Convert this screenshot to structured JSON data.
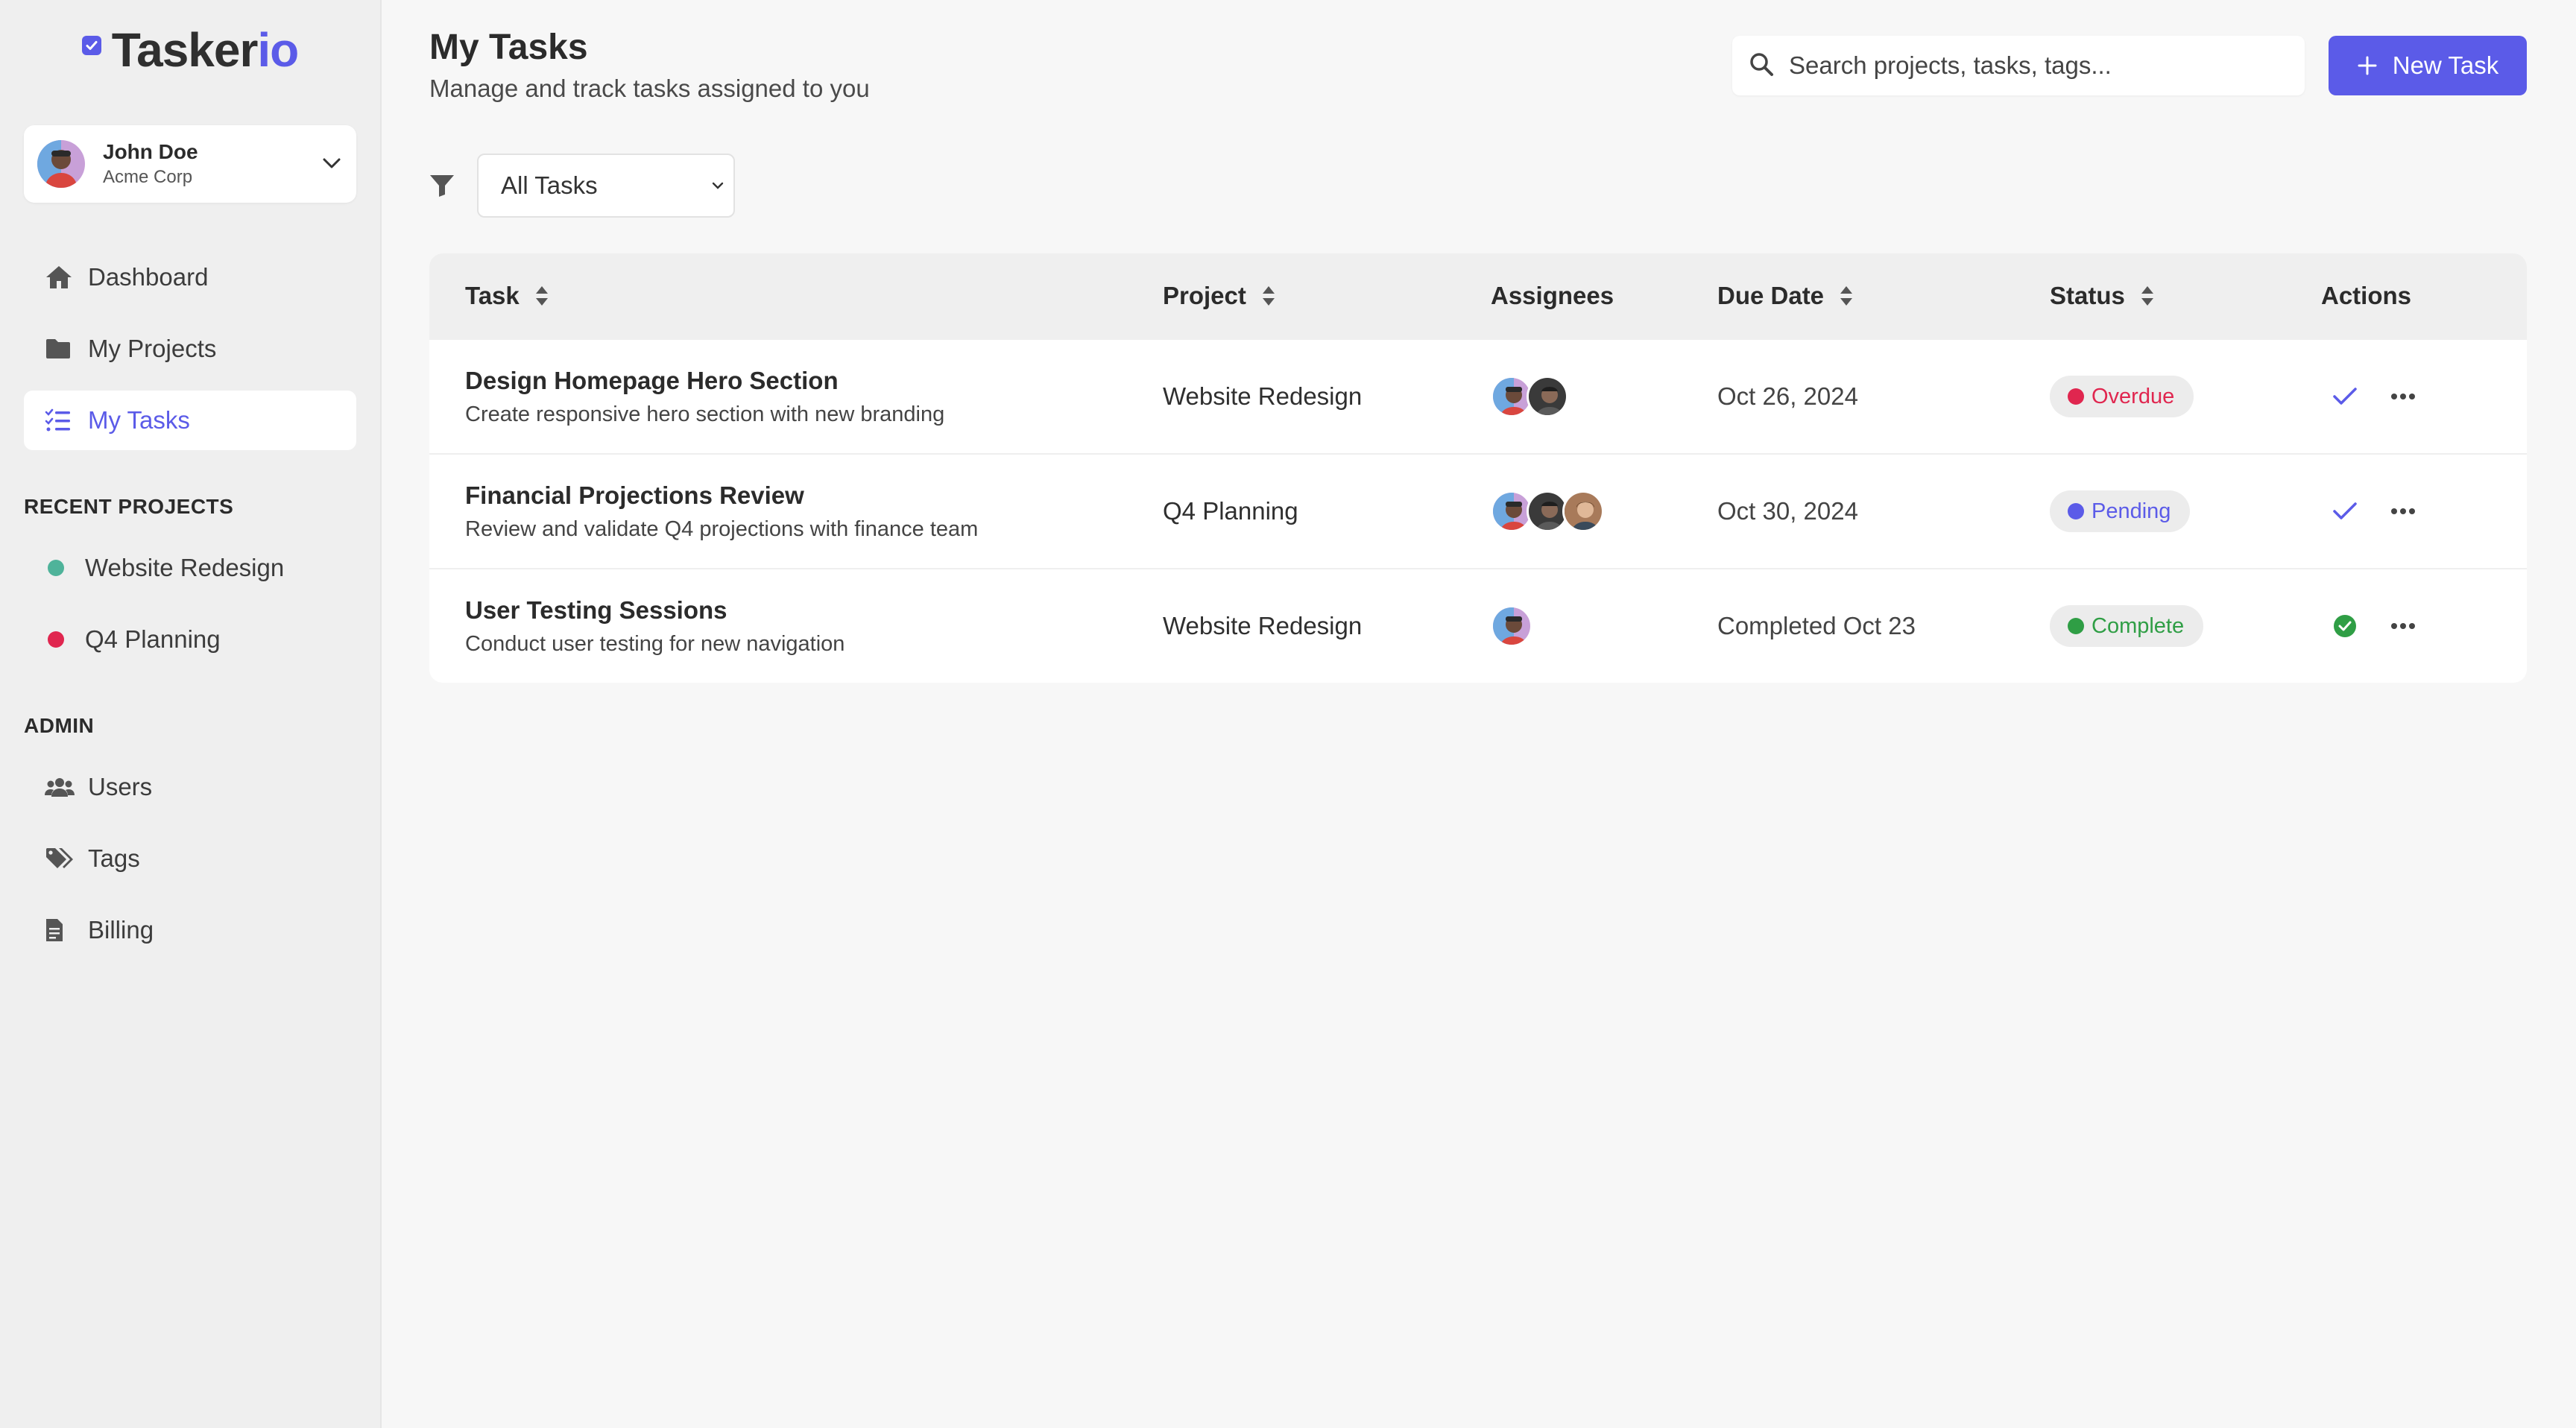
{
  "app": {
    "logo_main": "Tasker",
    "logo_accent": "io"
  },
  "user": {
    "name": "John Doe",
    "org": "Acme Corp"
  },
  "nav": {
    "items": [
      {
        "label": "Dashboard",
        "icon": "home-icon"
      },
      {
        "label": "My Projects",
        "icon": "folder-icon"
      },
      {
        "label": "My Tasks",
        "icon": "task-list-icon",
        "active": true
      }
    ]
  },
  "recent_projects": {
    "title": "RECENT PROJECTS",
    "items": [
      {
        "label": "Website Redesign",
        "color": "#4fb39a"
      },
      {
        "label": "Q4 Planning",
        "color": "#e0264f"
      }
    ]
  },
  "admin": {
    "title": "ADMIN",
    "items": [
      {
        "label": "Users",
        "icon": "users-icon"
      },
      {
        "label": "Tags",
        "icon": "tags-icon"
      },
      {
        "label": "Billing",
        "icon": "billing-icon"
      }
    ]
  },
  "header": {
    "title": "My Tasks",
    "subtitle": "Manage and track tasks assigned to you",
    "search_placeholder": "Search projects, tasks, tags...",
    "new_task_label": "New Task"
  },
  "filter": {
    "selected": "All Tasks"
  },
  "table": {
    "columns": [
      "Task",
      "Project",
      "Assignees",
      "Due Date",
      "Status",
      "Actions"
    ],
    "rows": [
      {
        "title": "Design Homepage Hero Section",
        "description": "Create responsive hero section with new branding",
        "project": "Website Redesign",
        "assignees": 2,
        "due": "Oct 26, 2024",
        "status": "Overdue",
        "status_class": "overdue",
        "action": "check"
      },
      {
        "title": "Financial Projections Review",
        "description": "Review and validate Q4 projections with finance team",
        "project": "Q4 Planning",
        "assignees": 3,
        "due": "Oct 30, 2024",
        "status": "Pending",
        "status_class": "pending",
        "action": "check"
      },
      {
        "title": "User Testing Sessions",
        "description": "Conduct user testing for new navigation",
        "project": "Website Redesign",
        "assignees": 1,
        "due": "Completed Oct 23",
        "status": "Complete",
        "status_class": "complete",
        "action": "done"
      }
    ]
  },
  "colors": {
    "accent": "#5b5be8",
    "overdue": "#e0264f",
    "pending": "#5b5be8",
    "complete": "#2f9e45"
  }
}
